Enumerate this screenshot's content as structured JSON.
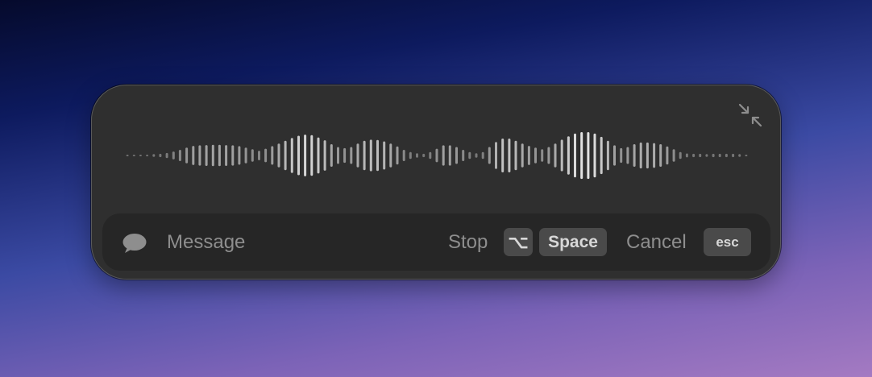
{
  "recorder": {
    "input_label": "Message",
    "stop_label": "Stop",
    "stop_keys": [
      "⌥",
      "Space"
    ],
    "cancel_label": "Cancel",
    "cancel_key": "esc",
    "icons": {
      "input": "speech-bubble-icon",
      "collapse": "collapse-arrows-icon"
    },
    "colors": {
      "panel": "#2f2f2f",
      "bar": "#262626",
      "key": "#4a4a4a",
      "text": "#8e8e8e"
    },
    "waveform_levels": [
      0.02,
      0.02,
      0.02,
      0.03,
      0.05,
      0.06,
      0.09,
      0.14,
      0.2,
      0.28,
      0.34,
      0.36,
      0.37,
      0.38,
      0.38,
      0.37,
      0.36,
      0.33,
      0.28,
      0.22,
      0.17,
      0.24,
      0.33,
      0.42,
      0.52,
      0.62,
      0.7,
      0.74,
      0.72,
      0.64,
      0.54,
      0.4,
      0.3,
      0.26,
      0.3,
      0.42,
      0.52,
      0.56,
      0.55,
      0.5,
      0.42,
      0.32,
      0.2,
      0.12,
      0.08,
      0.06,
      0.12,
      0.24,
      0.36,
      0.36,
      0.3,
      0.2,
      0.12,
      0.08,
      0.12,
      0.3,
      0.48,
      0.6,
      0.6,
      0.52,
      0.42,
      0.34,
      0.28,
      0.22,
      0.3,
      0.42,
      0.56,
      0.68,
      0.78,
      0.83,
      0.83,
      0.78,
      0.66,
      0.52,
      0.36,
      0.26,
      0.3,
      0.4,
      0.46,
      0.46,
      0.44,
      0.4,
      0.32,
      0.22,
      0.12,
      0.07,
      0.06,
      0.06,
      0.05,
      0.06,
      0.06,
      0.06,
      0.06,
      0.05,
      0.03
    ]
  }
}
